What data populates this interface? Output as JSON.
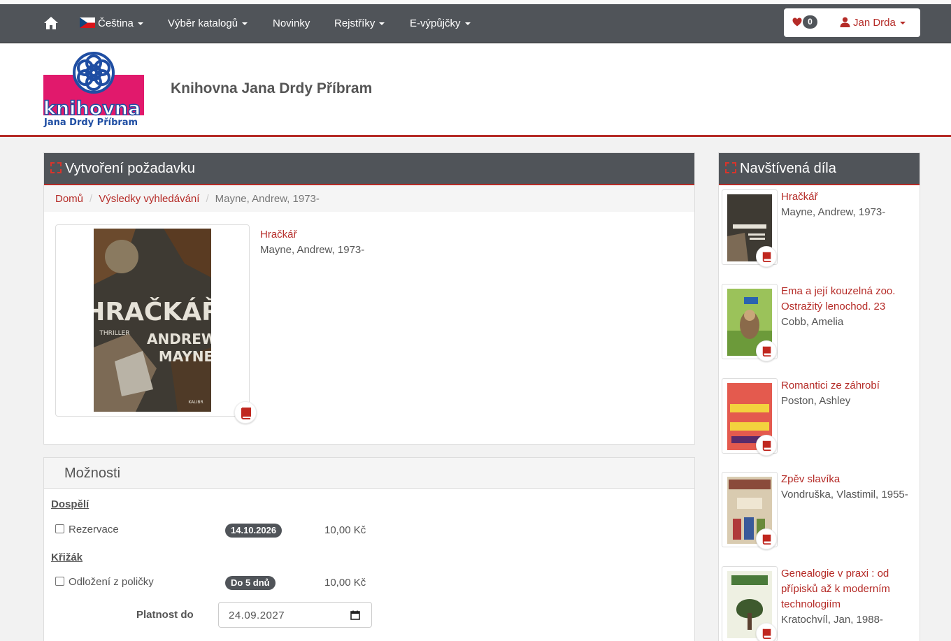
{
  "nav": {
    "language": "Čeština",
    "catalog": "Výběr katalogů",
    "news": "Novinky",
    "registers": "Rejstříky",
    "eloans": "E-výpůjčky",
    "favorites_count": "0",
    "user_name": "Jan Drda"
  },
  "header": {
    "logo_text": "knihovna",
    "logo_subtext": "Jana Drdy Příbram",
    "site_title": "Knihovna Jana Drdy Příbram"
  },
  "request": {
    "panel_title": "Vytvoření požadavku",
    "breadcrumb": [
      "Domů",
      "Výsledky vyhledávání",
      "Mayne, Andrew, 1973-"
    ],
    "book_title": "Hračkář",
    "book_author": "Mayne, Andrew, 1973-",
    "cover_title": "HRAČKÁŘ",
    "cover_author_1": "ANDREW",
    "cover_author_2": "MAYNE",
    "cover_genre": "THRILLER",
    "cover_publisher": "KALIBR"
  },
  "options": {
    "title": "Možnosti",
    "groups": [
      {
        "label": "Dospělí",
        "option": "Rezervace",
        "badge": "14.10.2026",
        "price": "10,00 Kč"
      },
      {
        "label": "Křižák",
        "option": "Odložení z poličky",
        "badge": "Do 5 dnů",
        "price": "10,00 Kč"
      }
    ],
    "valid_label": "Platnost do",
    "valid_value": "24.09.2027"
  },
  "visited": {
    "panel_title": "Navštívená díla",
    "items": [
      {
        "title": "Hračkář",
        "author": "Mayne, Andrew, 1973-"
      },
      {
        "title": "Ema a její kouzelná zoo. Ostražitý lenochod. 23",
        "author": "Cobb, Amelia"
      },
      {
        "title": "Romantici ze záhrobí",
        "author": "Poston, Ashley"
      },
      {
        "title": "Zpěv slavíka",
        "author": "Vondruška, Vlastimil, 1955-"
      },
      {
        "title": "Genealogie v praxi : od přípisků až k moderním technologiím",
        "author": "Kratochvíl, Jan, 1988-"
      }
    ]
  },
  "colors": {
    "accent": "#b52b27",
    "navbar": "#505459"
  }
}
